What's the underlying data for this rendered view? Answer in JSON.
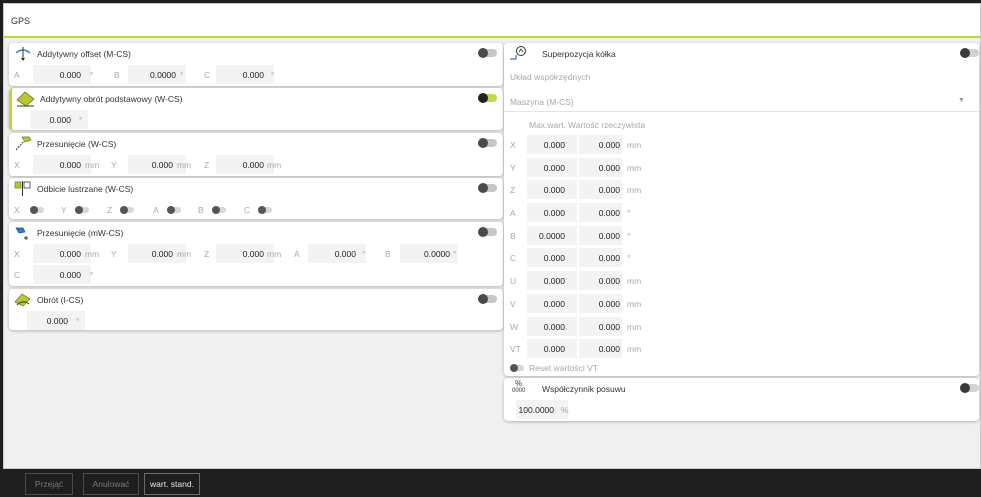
{
  "window": {
    "title": "GPS"
  },
  "left": {
    "additive_offset": {
      "title": "Addytywny offset (M-CS)",
      "fields": [
        {
          "label": "A",
          "value": "0.000",
          "unit": "°"
        },
        {
          "label": "B",
          "value": "0.0000",
          "unit": "°"
        },
        {
          "label": "C",
          "value": "0.000",
          "unit": "°"
        }
      ]
    },
    "additive_rotation": {
      "title": "Addytywny obrót podstawowy (W-CS)",
      "value": "0.000",
      "unit": "°"
    },
    "shift_wcs": {
      "title": "Przesunięcie (W-CS)",
      "fields": [
        {
          "label": "X",
          "value": "0.000",
          "unit": "mm"
        },
        {
          "label": "Y",
          "value": "0.000",
          "unit": "mm"
        },
        {
          "label": "Z",
          "value": "0.000",
          "unit": "mm"
        }
      ]
    },
    "mirror": {
      "title": "Odbicie lustrzane (W-CS)",
      "axes": [
        "X",
        "Y",
        "Z",
        "A",
        "B",
        "C"
      ]
    },
    "shift_mwcs": {
      "title": "Przesunięcie (mW-CS)",
      "fields": [
        {
          "label": "X",
          "value": "0.000",
          "unit": "mm"
        },
        {
          "label": "Y",
          "value": "0.000",
          "unit": "mm"
        },
        {
          "label": "Z",
          "value": "0.000",
          "unit": "mm"
        },
        {
          "label": "A",
          "value": "0.000",
          "unit": "°"
        },
        {
          "label": "B",
          "value": "0.0000",
          "unit": "°"
        }
      ],
      "c_label": "C",
      "c_value": "0.000",
      "c_unit": "°"
    },
    "rotation_ics": {
      "title": "Obrót (I-CS)",
      "value": "0.000",
      "unit": "°"
    }
  },
  "right": {
    "handwheel": {
      "title": "Superpozycja kółka",
      "coord_label": "Układ współrzędnych",
      "coord_value": "Maszyna (M-CS)",
      "col_max": "Max.wart.",
      "col_actual": "Wartość rzeczywista",
      "rows": [
        {
          "axis": "X",
          "max": "0.000",
          "actual": "0.000",
          "unit": "mm"
        },
        {
          "axis": "Y",
          "max": "0.000",
          "actual": "0.000",
          "unit": "mm"
        },
        {
          "axis": "Z",
          "max": "0.000",
          "actual": "0.000",
          "unit": "mm"
        },
        {
          "axis": "A",
          "max": "0.000",
          "actual": "0.000",
          "unit": "°"
        },
        {
          "axis": "B",
          "max": "0.0000",
          "actual": "0.000",
          "unit": "°"
        },
        {
          "axis": "C",
          "max": "0.000",
          "actual": "0.000",
          "unit": "°"
        },
        {
          "axis": "U",
          "max": "0.000",
          "actual": "0.000",
          "unit": "mm"
        },
        {
          "axis": "V",
          "max": "0.000",
          "actual": "0.000",
          "unit": "mm"
        },
        {
          "axis": "W",
          "max": "0.000",
          "actual": "0.000",
          "unit": "mm"
        },
        {
          "axis": "VT",
          "max": "0.000",
          "actual": "0.000",
          "unit": "mm"
        }
      ],
      "reset_label": "Reset wartości VT"
    },
    "feed": {
      "title": "Współczynnik posuwu",
      "value": "100.0000",
      "unit": "%",
      "icon_top": "%",
      "icon_bottom": "0000"
    }
  },
  "footer": {
    "accept": "Przejąć",
    "cancel": "Anulować",
    "default": "wart. stand."
  },
  "colors": {
    "accent": "#c4d430",
    "panel": "#ffffff",
    "background": "#f0f0f0",
    "footer": "#1e1e1e"
  }
}
